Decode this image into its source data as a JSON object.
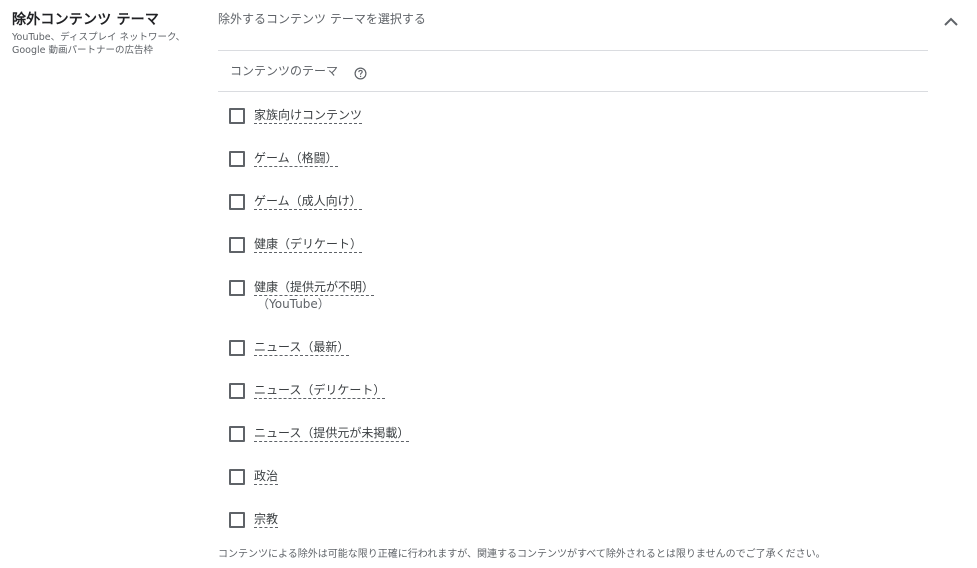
{
  "section": {
    "title": "除外コンテンツ テーマ",
    "description": "YouTube、ディスプレイ ネットワーク、Google 動画パートナーの広告枠"
  },
  "panel": {
    "header": "除外するコンテンツ テーマを選択する",
    "collapse_icon": "chevron-up-icon",
    "subheader": "コンテンツのテーマ",
    "help_icon": "help-circle-icon"
  },
  "options": [
    {
      "label": "家族向けコンテンツ",
      "checked": false
    },
    {
      "label": "ゲーム（格闘）",
      "checked": false
    },
    {
      "label": "ゲーム（成人向け）",
      "checked": false
    },
    {
      "label": "健康（デリケート）",
      "checked": false
    },
    {
      "label": "健康（提供元が不明）",
      "sub": "（YouTube）",
      "checked": false
    },
    {
      "label": "ニュース（最新）",
      "checked": false
    },
    {
      "label": "ニュース（デリケート）",
      "checked": false
    },
    {
      "label": "ニュース（提供元が未掲載）",
      "checked": false
    },
    {
      "label": "政治",
      "checked": false
    },
    {
      "label": "宗教",
      "checked": false
    }
  ],
  "footnote": "コンテンツによる除外は可能な限り正確に行われますが、関連するコンテンツがすべて除外されるとは限りませんのでご了承ください。",
  "colors": {
    "text_primary": "#202124",
    "text_secondary": "#5f6368",
    "divider": "#dadce0"
  }
}
